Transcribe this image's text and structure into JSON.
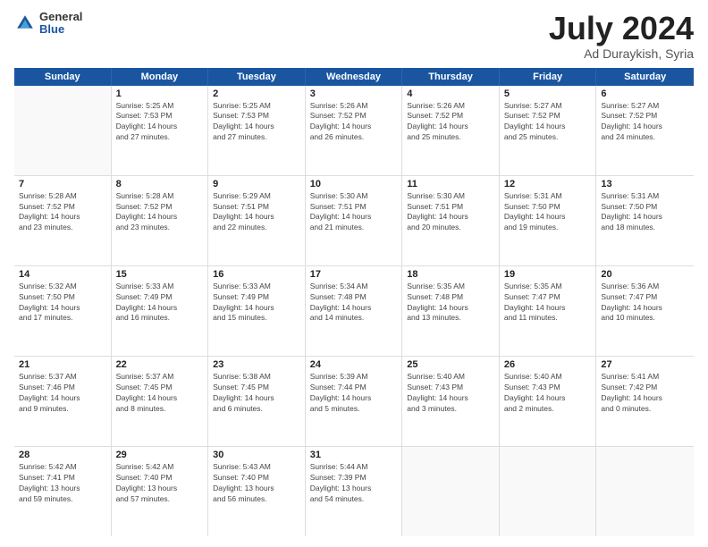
{
  "header": {
    "logo_general": "General",
    "logo_blue": "Blue",
    "month": "July 2024",
    "location": "Ad Duraykish, Syria"
  },
  "days": [
    "Sunday",
    "Monday",
    "Tuesday",
    "Wednesday",
    "Thursday",
    "Friday",
    "Saturday"
  ],
  "weeks": [
    [
      {
        "day": "",
        "lines": []
      },
      {
        "day": "1",
        "lines": [
          "Sunrise: 5:25 AM",
          "Sunset: 7:53 PM",
          "Daylight: 14 hours",
          "and 27 minutes."
        ]
      },
      {
        "day": "2",
        "lines": [
          "Sunrise: 5:25 AM",
          "Sunset: 7:53 PM",
          "Daylight: 14 hours",
          "and 27 minutes."
        ]
      },
      {
        "day": "3",
        "lines": [
          "Sunrise: 5:26 AM",
          "Sunset: 7:52 PM",
          "Daylight: 14 hours",
          "and 26 minutes."
        ]
      },
      {
        "day": "4",
        "lines": [
          "Sunrise: 5:26 AM",
          "Sunset: 7:52 PM",
          "Daylight: 14 hours",
          "and 25 minutes."
        ]
      },
      {
        "day": "5",
        "lines": [
          "Sunrise: 5:27 AM",
          "Sunset: 7:52 PM",
          "Daylight: 14 hours",
          "and 25 minutes."
        ]
      },
      {
        "day": "6",
        "lines": [
          "Sunrise: 5:27 AM",
          "Sunset: 7:52 PM",
          "Daylight: 14 hours",
          "and 24 minutes."
        ]
      }
    ],
    [
      {
        "day": "7",
        "lines": [
          "Sunrise: 5:28 AM",
          "Sunset: 7:52 PM",
          "Daylight: 14 hours",
          "and 23 minutes."
        ]
      },
      {
        "day": "8",
        "lines": [
          "Sunrise: 5:28 AM",
          "Sunset: 7:52 PM",
          "Daylight: 14 hours",
          "and 23 minutes."
        ]
      },
      {
        "day": "9",
        "lines": [
          "Sunrise: 5:29 AM",
          "Sunset: 7:51 PM",
          "Daylight: 14 hours",
          "and 22 minutes."
        ]
      },
      {
        "day": "10",
        "lines": [
          "Sunrise: 5:30 AM",
          "Sunset: 7:51 PM",
          "Daylight: 14 hours",
          "and 21 minutes."
        ]
      },
      {
        "day": "11",
        "lines": [
          "Sunrise: 5:30 AM",
          "Sunset: 7:51 PM",
          "Daylight: 14 hours",
          "and 20 minutes."
        ]
      },
      {
        "day": "12",
        "lines": [
          "Sunrise: 5:31 AM",
          "Sunset: 7:50 PM",
          "Daylight: 14 hours",
          "and 19 minutes."
        ]
      },
      {
        "day": "13",
        "lines": [
          "Sunrise: 5:31 AM",
          "Sunset: 7:50 PM",
          "Daylight: 14 hours",
          "and 18 minutes."
        ]
      }
    ],
    [
      {
        "day": "14",
        "lines": [
          "Sunrise: 5:32 AM",
          "Sunset: 7:50 PM",
          "Daylight: 14 hours",
          "and 17 minutes."
        ]
      },
      {
        "day": "15",
        "lines": [
          "Sunrise: 5:33 AM",
          "Sunset: 7:49 PM",
          "Daylight: 14 hours",
          "and 16 minutes."
        ]
      },
      {
        "day": "16",
        "lines": [
          "Sunrise: 5:33 AM",
          "Sunset: 7:49 PM",
          "Daylight: 14 hours",
          "and 15 minutes."
        ]
      },
      {
        "day": "17",
        "lines": [
          "Sunrise: 5:34 AM",
          "Sunset: 7:48 PM",
          "Daylight: 14 hours",
          "and 14 minutes."
        ]
      },
      {
        "day": "18",
        "lines": [
          "Sunrise: 5:35 AM",
          "Sunset: 7:48 PM",
          "Daylight: 14 hours",
          "and 13 minutes."
        ]
      },
      {
        "day": "19",
        "lines": [
          "Sunrise: 5:35 AM",
          "Sunset: 7:47 PM",
          "Daylight: 14 hours",
          "and 11 minutes."
        ]
      },
      {
        "day": "20",
        "lines": [
          "Sunrise: 5:36 AM",
          "Sunset: 7:47 PM",
          "Daylight: 14 hours",
          "and 10 minutes."
        ]
      }
    ],
    [
      {
        "day": "21",
        "lines": [
          "Sunrise: 5:37 AM",
          "Sunset: 7:46 PM",
          "Daylight: 14 hours",
          "and 9 minutes."
        ]
      },
      {
        "day": "22",
        "lines": [
          "Sunrise: 5:37 AM",
          "Sunset: 7:45 PM",
          "Daylight: 14 hours",
          "and 8 minutes."
        ]
      },
      {
        "day": "23",
        "lines": [
          "Sunrise: 5:38 AM",
          "Sunset: 7:45 PM",
          "Daylight: 14 hours",
          "and 6 minutes."
        ]
      },
      {
        "day": "24",
        "lines": [
          "Sunrise: 5:39 AM",
          "Sunset: 7:44 PM",
          "Daylight: 14 hours",
          "and 5 minutes."
        ]
      },
      {
        "day": "25",
        "lines": [
          "Sunrise: 5:40 AM",
          "Sunset: 7:43 PM",
          "Daylight: 14 hours",
          "and 3 minutes."
        ]
      },
      {
        "day": "26",
        "lines": [
          "Sunrise: 5:40 AM",
          "Sunset: 7:43 PM",
          "Daylight: 14 hours",
          "and 2 minutes."
        ]
      },
      {
        "day": "27",
        "lines": [
          "Sunrise: 5:41 AM",
          "Sunset: 7:42 PM",
          "Daylight: 14 hours",
          "and 0 minutes."
        ]
      }
    ],
    [
      {
        "day": "28",
        "lines": [
          "Sunrise: 5:42 AM",
          "Sunset: 7:41 PM",
          "Daylight: 13 hours",
          "and 59 minutes."
        ]
      },
      {
        "day": "29",
        "lines": [
          "Sunrise: 5:42 AM",
          "Sunset: 7:40 PM",
          "Daylight: 13 hours",
          "and 57 minutes."
        ]
      },
      {
        "day": "30",
        "lines": [
          "Sunrise: 5:43 AM",
          "Sunset: 7:40 PM",
          "Daylight: 13 hours",
          "and 56 minutes."
        ]
      },
      {
        "day": "31",
        "lines": [
          "Sunrise: 5:44 AM",
          "Sunset: 7:39 PM",
          "Daylight: 13 hours",
          "and 54 minutes."
        ]
      },
      {
        "day": "",
        "lines": []
      },
      {
        "day": "",
        "lines": []
      },
      {
        "day": "",
        "lines": []
      }
    ]
  ]
}
